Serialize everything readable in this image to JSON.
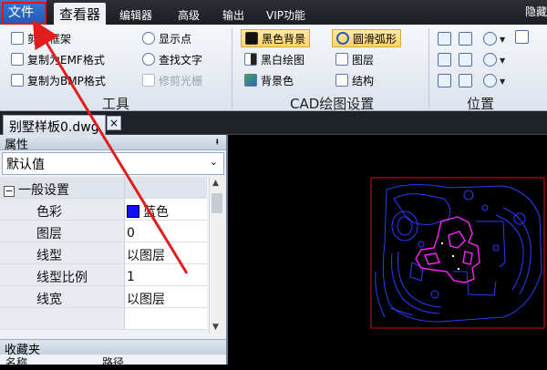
{
  "menubar": {
    "file": "文件",
    "tabs": [
      "查看器",
      "编辑器",
      "高级",
      "输出",
      "VIP功能"
    ],
    "right_text": "隐藏"
  },
  "ribbon": {
    "tools": {
      "label": "工具",
      "items": [
        "剪切框架",
        "复制为EMF格式",
        "复制为BMP格式",
        "显示点",
        "查找文字",
        "修剪光栅"
      ]
    },
    "cad_settings": {
      "label": "CAD绘图设置",
      "items": [
        "黑色背景",
        "黑白绘图",
        "背景色",
        "圆滑弧形",
        "图层",
        "结构"
      ]
    },
    "position": {
      "label": "位置"
    }
  },
  "document_tab": {
    "title": "别墅样板0.dwg",
    "close": "×"
  },
  "properties": {
    "title": "属性",
    "pin": "ᅟ",
    "dropdown": "默认值",
    "section": "一般设置",
    "rows": [
      {
        "key": "色彩",
        "value": "蓝色"
      },
      {
        "key": "图层",
        "value": "0"
      },
      {
        "key": "线型",
        "value": "以图层"
      },
      {
        "key": "线型比例",
        "value": "1"
      },
      {
        "key": "线宽",
        "value": "以图层"
      }
    ]
  },
  "favorites": {
    "title": "收藏夹",
    "col1": "名称",
    "col2": "路径"
  },
  "colors": {
    "accent": "#1f58b7",
    "annotation": "#e11d1d",
    "drawing_blue": "#2a3cff",
    "drawing_magenta": "#ff22ff"
  }
}
